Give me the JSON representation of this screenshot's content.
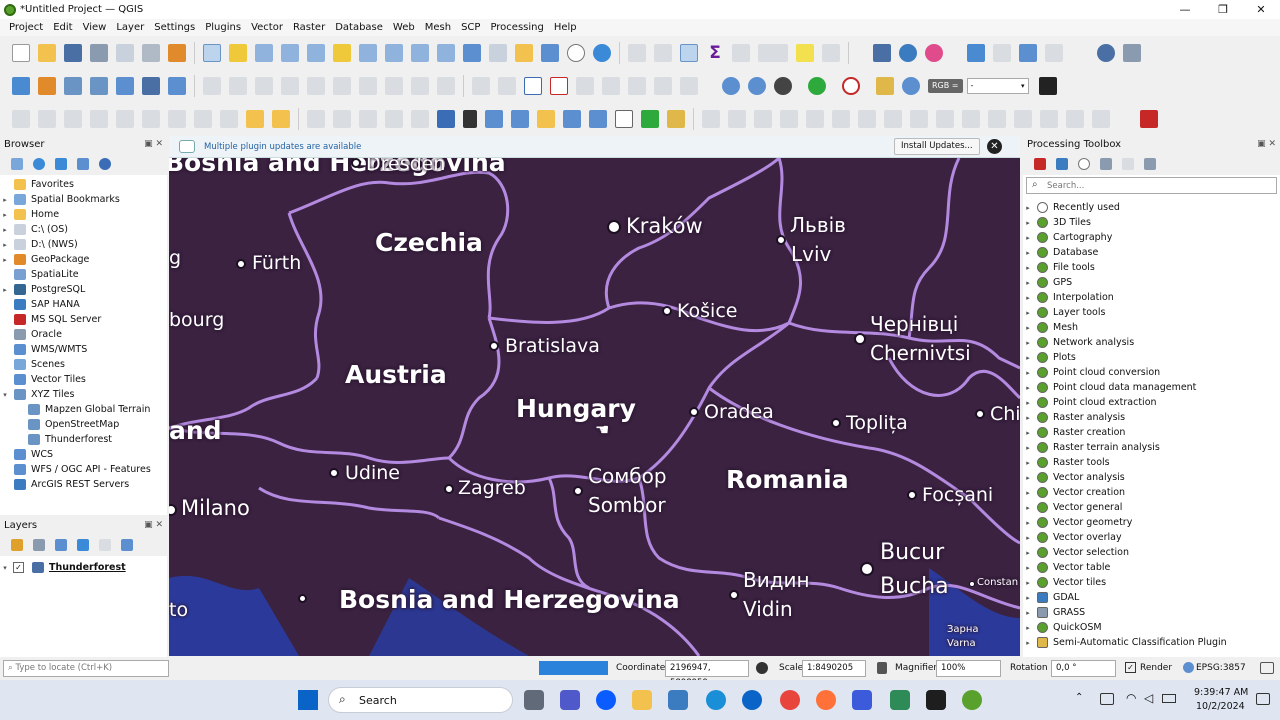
{
  "window": {
    "title": "*Untitled Project — QGIS",
    "min": "—",
    "max": "❐",
    "close": "✕"
  },
  "menu": [
    "Project",
    "Edit",
    "View",
    "Layer",
    "Settings",
    "Plugins",
    "Vector",
    "Raster",
    "Database",
    "Web",
    "Mesh",
    "SCP",
    "Processing",
    "Help"
  ],
  "toolbar": {
    "rgb_label": "RGB =",
    "band_value": "-"
  },
  "browser": {
    "title": "Browser",
    "items": [
      {
        "label": "Favorites",
        "icon": "star-icon",
        "expand": ""
      },
      {
        "label": "Spatial Bookmarks",
        "icon": "bookmark-icon",
        "expand": "▸"
      },
      {
        "label": "Home",
        "icon": "home-folder-icon",
        "expand": "▸"
      },
      {
        "label": "C:\\ (OS)",
        "icon": "drive-icon",
        "expand": "▸"
      },
      {
        "label": "D:\\ (NWS)",
        "icon": "drive-icon",
        "expand": "▸"
      },
      {
        "label": "GeoPackage",
        "icon": "geopackage-icon",
        "expand": "▸"
      },
      {
        "label": "SpatiaLite",
        "icon": "spatialite-icon",
        "expand": ""
      },
      {
        "label": "PostgreSQL",
        "icon": "postgresql-icon",
        "expand": "▸"
      },
      {
        "label": "SAP HANA",
        "icon": "sap-hana-icon",
        "expand": ""
      },
      {
        "label": "MS SQL Server",
        "icon": "mssql-icon",
        "expand": ""
      },
      {
        "label": "Oracle",
        "icon": "oracle-icon",
        "expand": ""
      },
      {
        "label": "WMS/WMTS",
        "icon": "wms-icon",
        "expand": ""
      },
      {
        "label": "Scenes",
        "icon": "scenes-icon",
        "expand": ""
      },
      {
        "label": "Vector Tiles",
        "icon": "vector-tiles-icon",
        "expand": ""
      },
      {
        "label": "XYZ Tiles",
        "icon": "xyz-tiles-icon",
        "expand": "▾"
      },
      {
        "label": "Mapzen Global Terrain",
        "icon": "tile-layer-icon",
        "expand": "",
        "indent": true
      },
      {
        "label": "OpenStreetMap",
        "icon": "tile-layer-icon",
        "expand": "",
        "indent": true
      },
      {
        "label": "Thunderforest",
        "icon": "tile-layer-icon",
        "expand": "",
        "indent": true
      },
      {
        "label": "WCS",
        "icon": "wcs-icon",
        "expand": ""
      },
      {
        "label": "WFS / OGC API - Features",
        "icon": "wfs-icon",
        "expand": ""
      },
      {
        "label": "ArcGIS REST Servers",
        "icon": "arcgis-icon",
        "expand": ""
      }
    ]
  },
  "layers": {
    "title": "Layers",
    "items": [
      {
        "label": "Thunderforest",
        "checked": "✓",
        "expand": "▾"
      }
    ]
  },
  "notification": {
    "message": "Multiple plugin updates are available",
    "button": "Install Updates...",
    "close": "✕"
  },
  "map": {
    "countries": [
      "Czechia",
      "Austria",
      "Hungary",
      "Romania",
      "Bosnia and Herzegovina",
      "ermany",
      "and",
      "bourg",
      "g",
      "to"
    ],
    "cities": [
      "Dresden",
      "Kraków",
      "Львів",
      "Lviv",
      "Fürth",
      "Košice",
      "Bratislava",
      "Чернівці",
      "Chernivtsi",
      "Oradea",
      "Toplița",
      "Chi",
      "Udine",
      "Zagreb",
      "Сомбор",
      "Sombor",
      "Focșani",
      "Milano",
      "Bucur",
      "Bucha",
      "Видин",
      "Vidin",
      "Constan",
      "Зарна",
      "Varna"
    ]
  },
  "processing": {
    "title": "Processing Toolbox",
    "search_placeholder": "Search...",
    "items": [
      {
        "label": "Recently used",
        "icon": "clock-icon"
      },
      {
        "label": "3D Tiles",
        "icon": "qgis-icon"
      },
      {
        "label": "Cartography",
        "icon": "qgis-icon"
      },
      {
        "label": "Database",
        "icon": "qgis-icon"
      },
      {
        "label": "File tools",
        "icon": "qgis-icon"
      },
      {
        "label": "GPS",
        "icon": "qgis-icon"
      },
      {
        "label": "Interpolation",
        "icon": "qgis-icon"
      },
      {
        "label": "Layer tools",
        "icon": "qgis-icon"
      },
      {
        "label": "Mesh",
        "icon": "qgis-icon"
      },
      {
        "label": "Network analysis",
        "icon": "qgis-icon"
      },
      {
        "label": "Plots",
        "icon": "qgis-icon"
      },
      {
        "label": "Point cloud conversion",
        "icon": "qgis-icon"
      },
      {
        "label": "Point cloud data management",
        "icon": "qgis-icon"
      },
      {
        "label": "Point cloud extraction",
        "icon": "qgis-icon"
      },
      {
        "label": "Raster analysis",
        "icon": "qgis-icon"
      },
      {
        "label": "Raster creation",
        "icon": "qgis-icon"
      },
      {
        "label": "Raster terrain analysis",
        "icon": "qgis-icon"
      },
      {
        "label": "Raster tools",
        "icon": "qgis-icon"
      },
      {
        "label": "Vector analysis",
        "icon": "qgis-icon"
      },
      {
        "label": "Vector creation",
        "icon": "qgis-icon"
      },
      {
        "label": "Vector general",
        "icon": "qgis-icon"
      },
      {
        "label": "Vector geometry",
        "icon": "qgis-icon"
      },
      {
        "label": "Vector overlay",
        "icon": "qgis-icon"
      },
      {
        "label": "Vector selection",
        "icon": "qgis-icon"
      },
      {
        "label": "Vector table",
        "icon": "qgis-icon"
      },
      {
        "label": "Vector tiles",
        "icon": "qgis-icon"
      },
      {
        "label": "GDAL",
        "icon": "gdal-icon"
      },
      {
        "label": "GRASS",
        "icon": "grass-icon"
      },
      {
        "label": "QuickOSM",
        "icon": "qgis-icon"
      },
      {
        "label": "Semi-Automatic Classification Plugin",
        "icon": "scp-icon"
      }
    ]
  },
  "status": {
    "locate_placeholder": "Type to locate (Ctrl+K)",
    "coordinate_label": "Coordinate",
    "coordinate_value": "2196947, 5898959",
    "scale_label": "Scale",
    "scale_value": "1:8490205",
    "magnifier_label": "Magnifier",
    "magnifier_value": "100%",
    "rotation_label": "Rotation",
    "rotation_value": "0,0 °",
    "render_label": "Render",
    "crs": "EPSG:3857"
  },
  "taskbar": {
    "search": "Search",
    "time": "9:39:47 AM",
    "date": "10/2/2024"
  },
  "colors": {
    "map_bg": "#3a2240",
    "border": "#b48ae0",
    "water": "#2b3a9a",
    "accent": "#2463a4"
  }
}
